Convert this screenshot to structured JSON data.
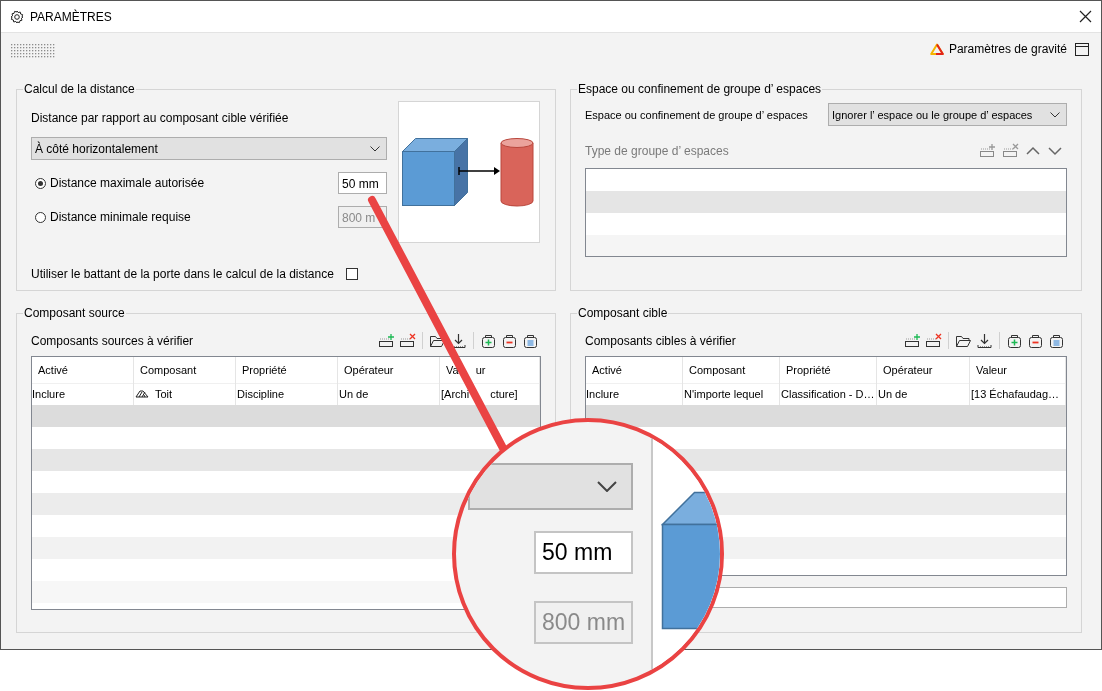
{
  "window": {
    "title": "PARAMÈTRES"
  },
  "toolbar": {
    "severity_button": "Paramètres de gravité"
  },
  "distance_group": {
    "title": "Calcul de la distance",
    "label": "Distance par rapport au composant cible vérifiée",
    "mode": "À côté horizontalement",
    "options": [
      {
        "label": "Distance maximale autorisée",
        "selected": true,
        "value": "50 mm",
        "disabled": false
      },
      {
        "label": "Distance minimale requise",
        "selected": false,
        "value": "800 m",
        "disabled": true
      }
    ],
    "door_swing": {
      "label": "Utiliser le battant de la porte dans le calcul de la distance",
      "checked": false
    }
  },
  "space_group": {
    "title": "Espace ou confinement de groupe d’ espaces",
    "label": "Espace ou confinement de groupe d’ espaces",
    "value": "Ignorer l’ espace ou le groupe d’ espaces",
    "type_list": {
      "label": "Type de groupe d’ espaces",
      "disabled": true
    }
  },
  "source_group": {
    "title": "Composant source",
    "label": "Composants sources à vérifier",
    "columns": [
      "Activé",
      "Composant",
      "Propriété",
      "Opérateur",
      [
        "Va",
        "ur"
      ]
    ],
    "rows": [
      {
        "cells": [
          "Inclure",
          "Toit",
          "Discipline",
          "Un de",
          [
            "[Archi",
            "cture]"
          ]
        ],
        "has_icon": true
      }
    ]
  },
  "target_group": {
    "title": "Composant cible",
    "label": "Composants cibles à vérifier",
    "columns": [
      "Activé",
      "Composant",
      "Propriété",
      "Opérateur",
      "Valeur"
    ],
    "rows": [
      {
        "cells": [
          "Inclure",
          "N'importe lequel",
          "Classification - D…",
          "Un de",
          "[13 Échafaudag…"
        ],
        "has_icon": false
      }
    ]
  },
  "magnifier": {
    "max_value": "50 mm",
    "min_value": "800 mm"
  }
}
